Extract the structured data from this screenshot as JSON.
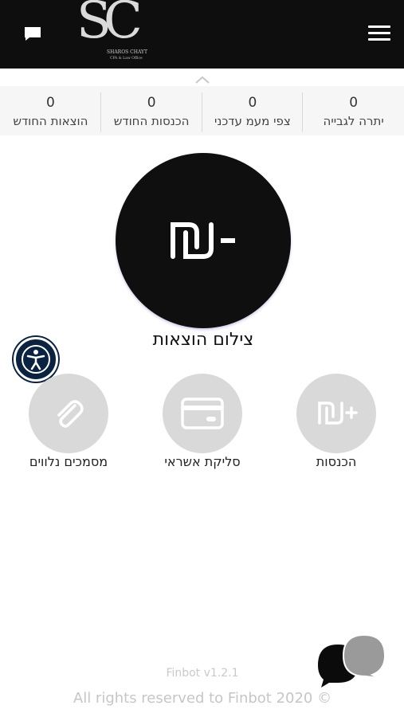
{
  "header": {
    "logo": {
      "monogram": "SC",
      "name": "SHAROS CHAYT",
      "subtitle": "CPA & Law Office"
    },
    "chat_icon": "chat-bubble-icon",
    "menu_icon": "hamburger-menu-icon",
    "background": "#0e0e0e"
  },
  "stats": [
    {
      "value": "0",
      "label": "יתרה לגבייה"
    },
    {
      "value": "0",
      "label": "צפי מעמ עדכני"
    },
    {
      "value": "0",
      "label": "הכנסות החודש"
    },
    {
      "value": "0",
      "label": "הוצאות החודש"
    }
  ],
  "main_action": {
    "label": "צילום הוצאות",
    "icon": "minus-shekel-icon",
    "color": "#0f0f0f"
  },
  "actions": [
    {
      "label": "הכנסות",
      "icon": "plus-shekel-icon"
    },
    {
      "label": "סליקת אשראי",
      "icon": "credit-card-icon"
    },
    {
      "label": "מסמכים נלווים",
      "icon": "paperclip-icon"
    }
  ],
  "footer": {
    "version": "Finbot v1.2.1",
    "rights": "All rights reserved to Finbot 2020 ©"
  },
  "accessibility_icon": "accessibility-person-icon"
}
